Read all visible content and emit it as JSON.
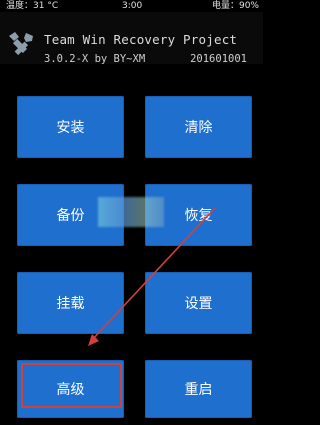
{
  "status_bar": {
    "temperature": "温度：31 °C",
    "time": "3:00",
    "battery": "电量：90%"
  },
  "header": {
    "title": "Team Win Recovery Project",
    "version": "3.0.2-X by BY~XM",
    "build": "201601001",
    "logo_icon": "twrp-logo-icon"
  },
  "main": {
    "buttons": {
      "install": "安装",
      "wipe": "清除",
      "backup": "备份",
      "restore": "恢复",
      "mount": "挂载",
      "settings": "设置",
      "advanced": "高级",
      "reboot": "重启"
    }
  },
  "colors": {
    "button_bg": "#1f6fcf",
    "background": "#000000",
    "highlight": "#d2403a"
  }
}
